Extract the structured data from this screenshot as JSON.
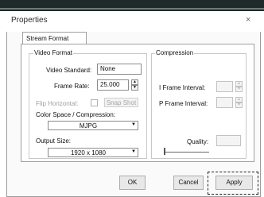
{
  "dialog": {
    "title": "Properties",
    "close_symbol": "×",
    "tab_label": "Stream Format"
  },
  "video_format": {
    "legend": "Video Format",
    "standard_label": "Video Standard:",
    "standard_value": "None",
    "frame_rate_label": "Frame Rate:",
    "frame_rate_value": "25.000",
    "flip_horizontal_label": "Flip Horizontal:",
    "snap_shot_label": "Snap Shot",
    "color_space_label": "Color Space / Compression:",
    "color_space_value": "MJPG",
    "output_size_label": "Output Size:",
    "output_size_value": "1920 x 1080"
  },
  "compression": {
    "legend": "Compression",
    "i_frame_label": "I Frame Interval:",
    "p_frame_label": "P Frame Interval:",
    "quality_label": "Quality:"
  },
  "buttons": {
    "ok": "OK",
    "cancel": "Cancel",
    "apply": "Apply"
  },
  "icons": {
    "spin_up": "▲",
    "spin_down": "▼",
    "dropdown": "▼"
  }
}
